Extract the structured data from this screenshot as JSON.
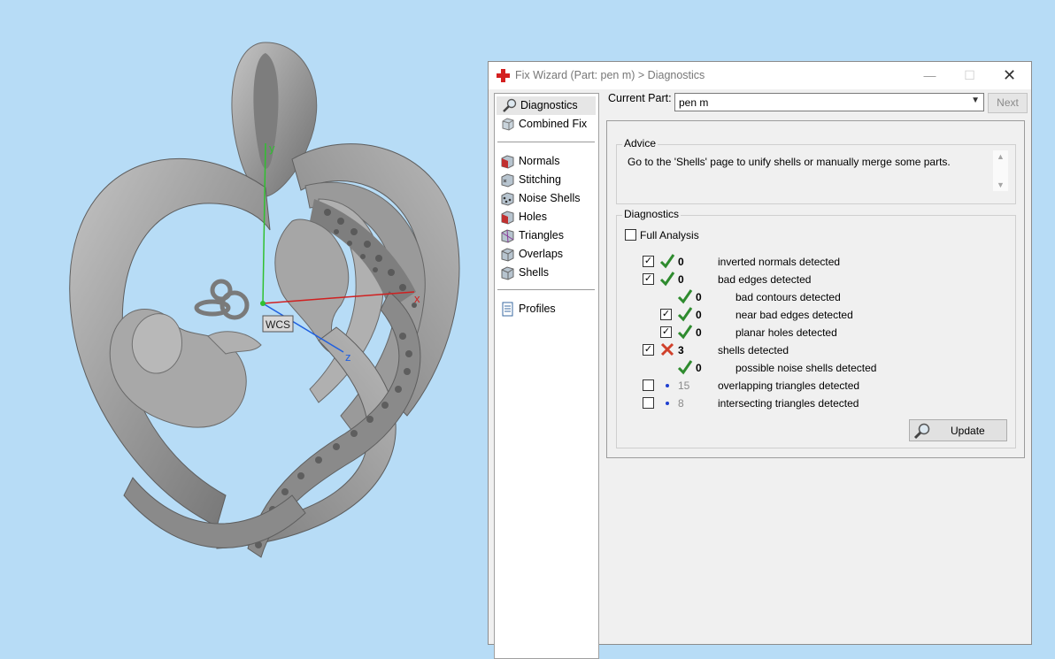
{
  "viewport": {
    "axis_labels": {
      "x": "x",
      "y": "y",
      "z": "z"
    },
    "wcs_label": "WCS"
  },
  "window": {
    "title": "Fix Wizard (Part: pen m) > Diagnostics",
    "controls": {
      "minimize": "—",
      "maximize": "☐",
      "close": "✕"
    }
  },
  "nav": {
    "items": [
      {
        "label": "Diagnostics",
        "icon": "magnifier-icon",
        "active": true
      },
      {
        "label": "Combined Fix",
        "icon": "cube-icon"
      },
      {
        "label": "Normals",
        "icon": "normals-cube-icon"
      },
      {
        "label": "Stitching",
        "icon": "stitching-cube-icon"
      },
      {
        "label": "Noise Shells",
        "icon": "noise-shells-cube-icon"
      },
      {
        "label": "Holes",
        "icon": "holes-cube-icon"
      },
      {
        "label": "Triangles",
        "icon": "triangles-cube-icon"
      },
      {
        "label": "Overlaps",
        "icon": "overlaps-cube-icon"
      },
      {
        "label": "Shells",
        "icon": "shells-cube-icon"
      },
      {
        "label": "Profiles",
        "icon": "document-icon"
      }
    ]
  },
  "current_part": {
    "label": "Current Part:",
    "value": "pen m"
  },
  "next_button": "Next",
  "advice": {
    "title": "Advice",
    "text": "Go to the 'Shells' page to unify shells or manually merge some parts."
  },
  "diagnostics": {
    "title": "Diagnostics",
    "full_analysis_label": "Full Analysis",
    "full_analysis_checked": false,
    "rows": [
      {
        "count": "0",
        "label": "inverted normals detected",
        "status": "ok",
        "checkbox": true,
        "checked": true,
        "indent": 0
      },
      {
        "count": "0",
        "label": "bad edges detected",
        "status": "ok",
        "checkbox": true,
        "checked": true,
        "indent": 0
      },
      {
        "count": "0",
        "label": "bad contours detected",
        "status": "ok",
        "checkbox": false,
        "indent": 1
      },
      {
        "count": "0",
        "label": "near bad edges detected",
        "status": "ok",
        "checkbox": true,
        "checked": true,
        "indent": 1
      },
      {
        "count": "0",
        "label": "planar holes detected",
        "status": "ok",
        "checkbox": true,
        "checked": true,
        "indent": 1
      },
      {
        "count": "3",
        "label": "shells detected",
        "status": "error",
        "checkbox": true,
        "checked": true,
        "indent": 0
      },
      {
        "count": "0",
        "label": "possible noise shells detected",
        "status": "ok",
        "checkbox": false,
        "indent": 1
      },
      {
        "count": "15",
        "label": "overlapping triangles detected",
        "status": "not-checked",
        "checkbox": true,
        "checked": false,
        "indent": 0
      },
      {
        "count": "8",
        "label": "intersecting triangles detected",
        "status": "not-checked",
        "checkbox": true,
        "checked": false,
        "indent": 0
      }
    ],
    "update_button": "Update"
  },
  "colors": {
    "viewport_bg": "#b7dcf6",
    "model_gray": "#8c8c8c",
    "ok_green": "#2e8b2e",
    "error_red": "#d0402a",
    "dot_blue": "#1f3fd0",
    "axis_x": "#d02020",
    "axis_y": "#30c030",
    "axis_z": "#2060e0"
  }
}
